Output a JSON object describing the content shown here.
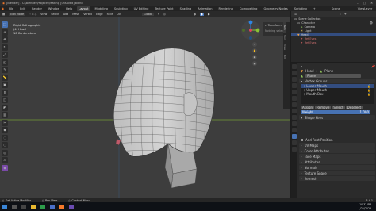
{
  "window": {
    "title": "[Blender] - C:\\Blender\\Projects\\Making [unsaved].blend",
    "controls": [
      "–",
      "▢",
      "✕"
    ]
  },
  "menubar": {
    "menus": [
      "File",
      "Edit",
      "Render",
      "Window",
      "Help"
    ],
    "workspaces": [
      "Layout",
      "Modeling",
      "Sculpting",
      "UV Editing",
      "Texture Paint",
      "Shading",
      "Animation",
      "Rendering",
      "Compositing",
      "Geometry Nodes",
      "Scripting"
    ],
    "active_workspace": "Layout",
    "scene": "Scene",
    "view_layer": "ViewLayer"
  },
  "viewport_header": {
    "mode": "Edit Mode",
    "items": [
      "View",
      "Select",
      "Add",
      "Mesh",
      "Vertex",
      "Edge",
      "Face",
      "UV"
    ],
    "transform": "Global"
  },
  "viewport": {
    "view_name": "Right Orthographic",
    "object": "(4) Head",
    "units": "10 Centimeters",
    "tools": [
      "select",
      "cursor",
      "move",
      "rotate",
      "scale",
      "transform",
      "annotate",
      "measure",
      "add-cube",
      "extrude",
      "inset",
      "bevel",
      "loopcut",
      "knife",
      "polybuild",
      "spin",
      "smooth",
      "shrink",
      "shear",
      "rip"
    ]
  },
  "transform_panel": {
    "title": "Transform",
    "message": "Nothing selected"
  },
  "sidebar_tabs": [
    "Item",
    "Tool",
    "View",
    "Edit"
  ],
  "outliner": {
    "title": "Scene Collection",
    "items": [
      {
        "label": "Character",
        "indent": 1,
        "selected": false
      },
      {
        "label": "Camera",
        "indent": 2,
        "selected": false
      },
      {
        "label": "Light",
        "indent": 2,
        "selected": false
      },
      {
        "label": "Head",
        "indent": 1,
        "selected": true
      },
      {
        "label": "Ref Eyes",
        "indent": 2,
        "selected": false
      },
      {
        "label": "Ref Eyes",
        "indent": 2,
        "selected": false
      }
    ]
  },
  "properties": {
    "breadcrumb_object": "Head",
    "breadcrumb_data": "Plane",
    "data_name": "Plane",
    "vertex_groups_label": "Vertex Groups",
    "shape_keys_label": "Shape Keys",
    "groups": [
      {
        "name": "Lower Mouth",
        "selected": true
      },
      {
        "name": "Upper Mouth",
        "selected": false
      },
      {
        "name": "Mouth Box",
        "selected": false
      }
    ],
    "group_buttons": [
      "Assign",
      "Remove",
      "Select",
      "Deselect"
    ],
    "weight_label": "Weight",
    "weight_value": "1.000",
    "add_rest_label": "Add Rest Position",
    "sections": [
      "UV Maps",
      "Color Attributes",
      "Face Maps",
      "Attributes",
      "Normals",
      "Texture Space",
      "Remesh"
    ]
  },
  "statusbar": {
    "items": [
      "Set Active Modifier",
      "Pan View",
      "Context Menu"
    ],
    "version": "3.4.1"
  },
  "taskbar": {
    "time": "10:32 PM",
    "date": "1/22/2023"
  },
  "colors": {
    "accent": "#4772b3",
    "viewport_bg": "#3d3d3d",
    "x_axis": "#e2415b",
    "y_axis": "#8ac233",
    "z_axis": "#2f86e3"
  }
}
